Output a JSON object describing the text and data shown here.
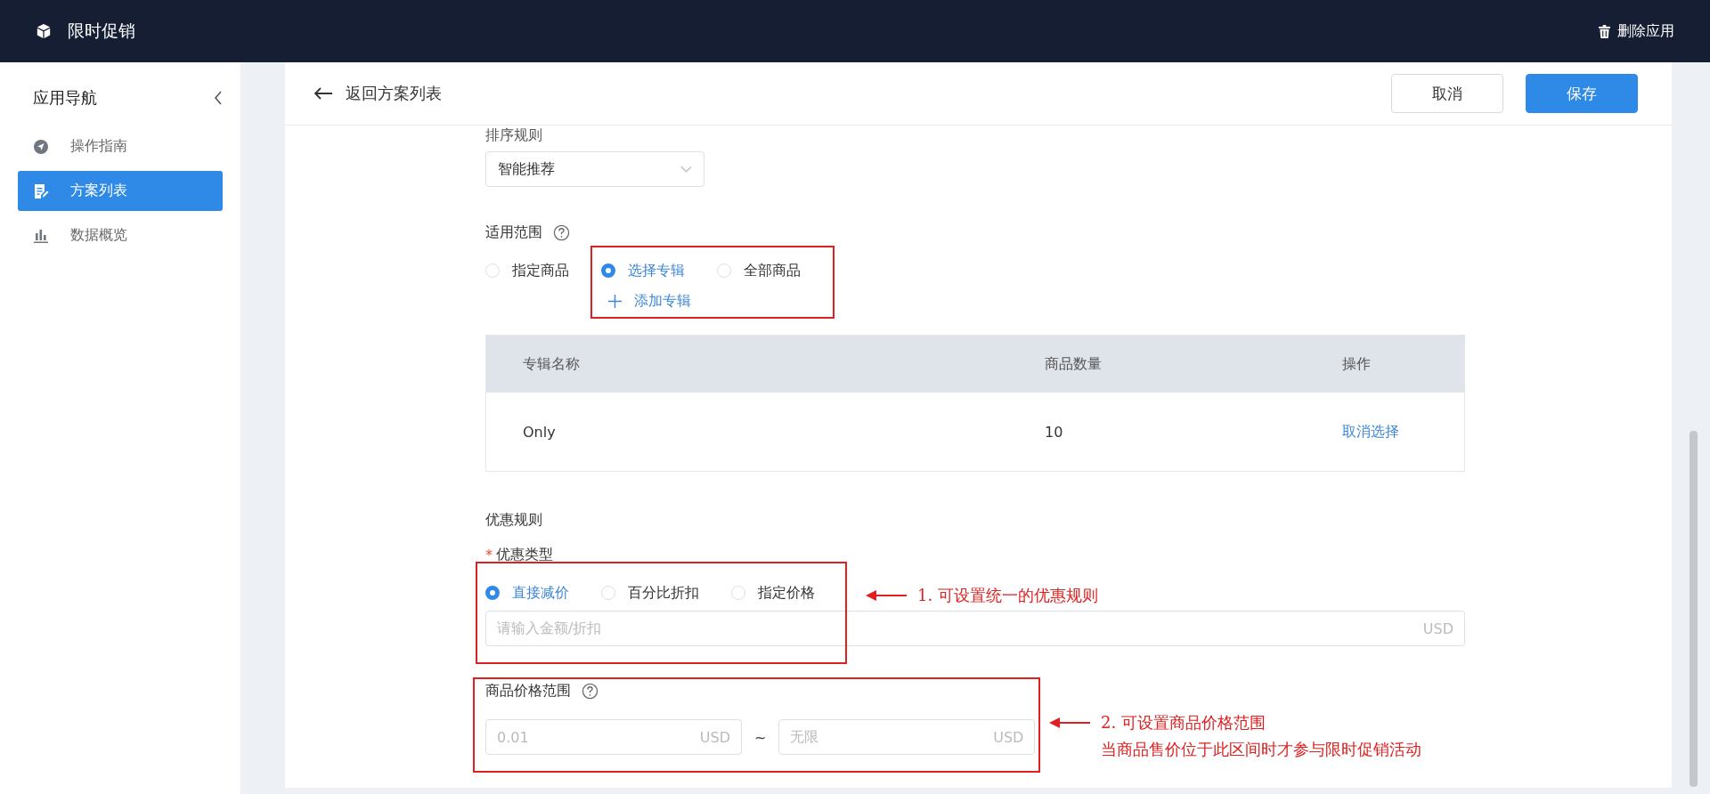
{
  "app_bar": {
    "title": "限时促销",
    "action": "删除应用"
  },
  "sidebar": {
    "title": "应用导航",
    "items": [
      {
        "label": "操作指南",
        "selected": false
      },
      {
        "label": "方案列表",
        "selected": true
      },
      {
        "label": "数据概览",
        "selected": false
      }
    ]
  },
  "header": {
    "back": "返回方案列表",
    "buttons": [
      {
        "label": "取消",
        "kind": "default"
      },
      {
        "label": "保存",
        "kind": "primary"
      }
    ]
  },
  "sort": {
    "label": "排序规则",
    "value": "智能推荐"
  },
  "scope": {
    "label": "适用范围",
    "options": [
      {
        "label": "指定商品",
        "selected": false
      },
      {
        "label": "选择专辑",
        "selected": true
      },
      {
        "label": "全部商品",
        "selected": false
      }
    ],
    "add_link": "添加专辑"
  },
  "table": {
    "columns": [
      "专辑名称",
      "商品数量",
      "操作"
    ],
    "rows": [
      {
        "cells": [
          "Only",
          "10"
        ],
        "action": "取消选择"
      }
    ]
  },
  "discount": {
    "section": "优惠规则",
    "label": "优惠类型",
    "required_mark": "*",
    "options": [
      {
        "label": "直接减价",
        "selected": true
      },
      {
        "label": "百分比折扣",
        "selected": false
      },
      {
        "label": "指定价格",
        "selected": false
      }
    ],
    "input": {
      "placeholder": "请输入金额/折扣",
      "unit": "USD"
    }
  },
  "price_range": {
    "label": "商品价格范围",
    "min": {
      "placeholder": "0.01",
      "unit": "USD"
    },
    "separator": "~",
    "max": {
      "placeholder": "无限",
      "unit": "USD"
    }
  },
  "annotations": [
    {
      "lines": [
        "1. 可设置统一的优惠规则"
      ]
    },
    {
      "lines": [
        "2. 可设置商品价格范围",
        "当商品售价位于此区间时才参与限时促销活动"
      ]
    }
  ]
}
